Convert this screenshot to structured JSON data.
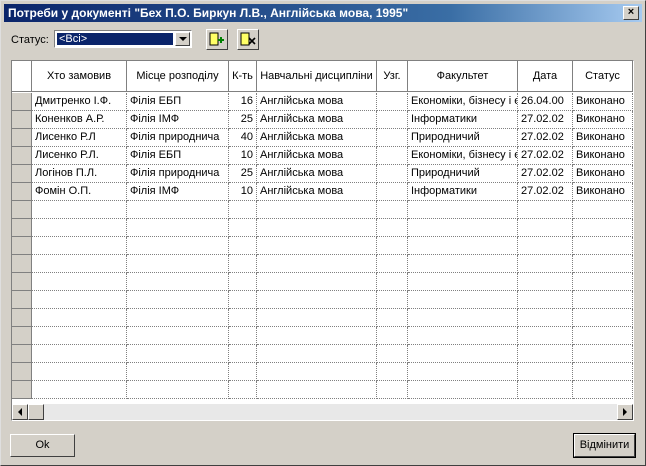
{
  "window": {
    "title": "Потреби у документі \"Бех П.О. Биркун Л.В., Англійська мова, 1995\""
  },
  "toolbar": {
    "status_label": "Статус:",
    "status_value": "<Всі>",
    "add_icon": "add-record-icon",
    "delete_icon": "delete-record-icon"
  },
  "table": {
    "headers": {
      "who": "Хто замовив",
      "place": "Місце розподілу",
      "qty": "К-ть",
      "disc": "Навчальні дисципліни",
      "agr": "Узг.",
      "fac": "Факультет",
      "date": "Дата",
      "status": "Статус"
    },
    "rows": [
      {
        "who": "Дмитренко І.Ф.",
        "place": "Філія ЕБП",
        "qty": "16",
        "disc": "Англійська мова",
        "agr": "",
        "fac": "Економіки, бізнесу і е",
        "date": "26.04.00",
        "status": "Виконано"
      },
      {
        "who": "Коненков А.Р.",
        "place": "Філія ІМФ",
        "qty": "25",
        "disc": "Англійська мова",
        "agr": "",
        "fac": "Інформатики",
        "date": "27.02.02",
        "status": "Виконано"
      },
      {
        "who": "Лисенко Р.Л",
        "place": "Філія природнича",
        "qty": "40",
        "disc": "Англійська мова",
        "agr": "",
        "fac": "Природничий",
        "date": "27.02.02",
        "status": "Виконано"
      },
      {
        "who": "Лисенко Р.Л.",
        "place": "Філія ЕБП",
        "qty": "10",
        "disc": "Англійська мова",
        "agr": "",
        "fac": "Економіки, бізнесу і е",
        "date": "27.02.02",
        "status": "Виконано"
      },
      {
        "who": "Логінов П.Л.",
        "place": "Філія природнича",
        "qty": "25",
        "disc": "Англійська мова",
        "agr": "",
        "fac": "Природничий",
        "date": "27.02.02",
        "status": "Виконано"
      },
      {
        "who": "Фомін О.П.",
        "place": "Філія ІМФ",
        "qty": "10",
        "disc": "Англійська мова",
        "agr": "",
        "fac": "Інформатики",
        "date": "27.02.02",
        "status": "Виконано"
      }
    ]
  },
  "buttons": {
    "ok": "Ok",
    "cancel": "Відмінити"
  }
}
